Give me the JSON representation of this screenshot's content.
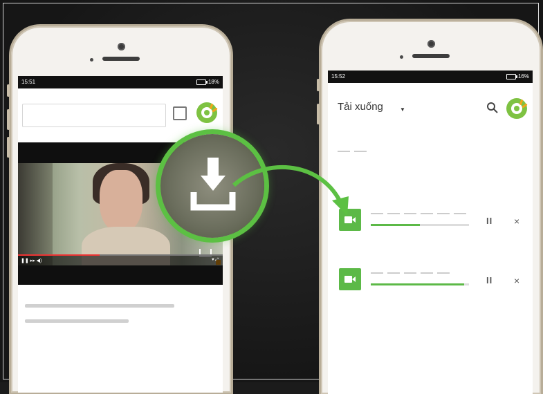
{
  "left_phone": {
    "status": {
      "time": "15:51",
      "battery": "18%"
    }
  },
  "right_phone": {
    "status": {
      "time": "15:52",
      "battery": "16%"
    },
    "header": {
      "title": "Tải xuống",
      "dropdown_icon": "caret-down-icon",
      "search_icon": "search-icon"
    },
    "downloads": [
      {
        "icon": "video-camera-icon",
        "progress": 0.5,
        "pause_label": "II",
        "close_label": "×"
      },
      {
        "icon": "video-camera-icon",
        "progress": 0.95,
        "pause_label": "II",
        "close_label": "×"
      }
    ]
  },
  "video": {
    "progress": 0.4
  },
  "overlay": {
    "icon": "download-icon"
  },
  "colors": {
    "accent_green": "#5cb947",
    "logo_orange": "#f2a51a",
    "background": "#1b1b1b"
  }
}
